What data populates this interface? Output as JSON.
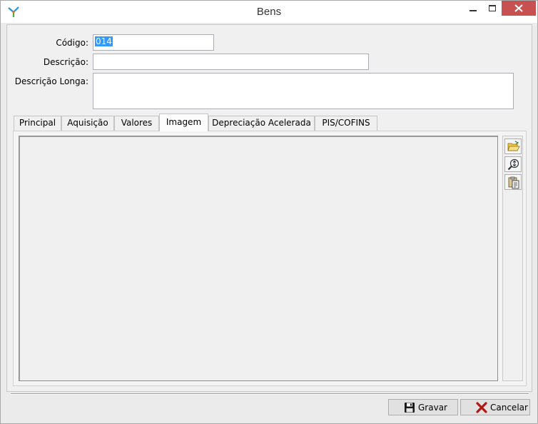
{
  "window": {
    "title": "Bens",
    "controls": [
      "minimize-icon",
      "maximize-icon",
      "close-icon"
    ]
  },
  "form": {
    "codigo": {
      "label": "Código:",
      "value": "014"
    },
    "descricao": {
      "label": "Descrição:",
      "value": ""
    },
    "descricao_longa": {
      "label": "Descrição Longa:",
      "value": ""
    }
  },
  "tabs": [
    {
      "label": "Principal"
    },
    {
      "label": "Aquisição"
    },
    {
      "label": "Valores"
    },
    {
      "label": "Imagem",
      "active": true
    },
    {
      "label": "Depreciação Acelerada"
    },
    {
      "label": "PIS/COFINS"
    }
  ],
  "image_tools": [
    "open-folder-icon",
    "zoom-icon",
    "paste-icon"
  ],
  "footer": {
    "gravar_label": "Gravar",
    "cancelar_label": "Cancelar"
  },
  "colors": {
    "close_button": "#c75050",
    "selection": "#3399ff"
  }
}
